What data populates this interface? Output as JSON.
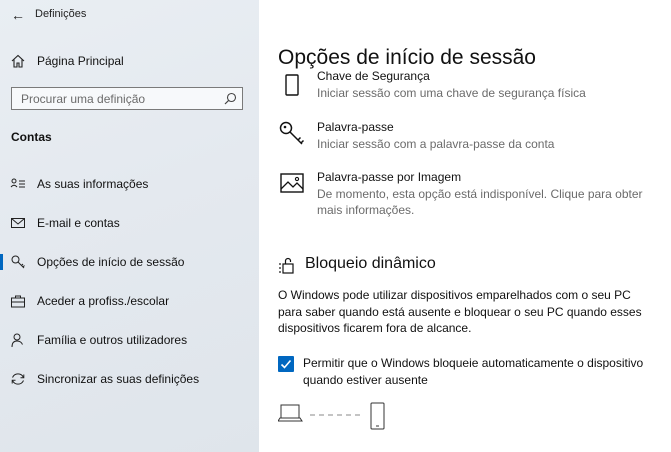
{
  "window": {
    "back_glyph": "←",
    "title": "Definições"
  },
  "sidebar": {
    "home_label": "Página Principal",
    "search": {
      "placeholder": "Procurar uma definição",
      "value": ""
    },
    "section_heading": "Contas",
    "items": [
      {
        "label": "As suas informações",
        "icon": "person-card-icon",
        "selected": false
      },
      {
        "label": "E-mail e contas",
        "icon": "mail-icon",
        "selected": false
      },
      {
        "label": "Opções de início de sessão",
        "icon": "key-icon",
        "selected": true
      },
      {
        "label": "Aceder a profiss./escolar",
        "icon": "briefcase-icon",
        "selected": false
      },
      {
        "label": "Família e outros utilizadores",
        "icon": "person-icon",
        "selected": false
      },
      {
        "label": "Sincronizar as suas definições",
        "icon": "sync-icon",
        "selected": false
      }
    ]
  },
  "main": {
    "title": "Opções de início de sessão",
    "options": [
      {
        "title": "Chave de Segurança",
        "description": "Iniciar sessão com uma chave de segurança física",
        "icon": "usb-key-icon"
      },
      {
        "title": "Palavra-passe",
        "description": "Iniciar sessão com a palavra-passe da conta",
        "icon": "key-icon"
      },
      {
        "title": "Palavra-passe por Imagem",
        "description": "De momento, esta opção está indisponível. Clique para obter mais informações.",
        "icon": "picture-icon"
      }
    ],
    "dynamic_lock": {
      "heading": "Bloqueio dinâmico",
      "description": "O Windows pode utilizar dispositivos emparelhados com o seu PC para saber quando está ausente e bloquear o seu PC quando esses dispositivos ficarem fora de alcance.",
      "checkbox_label": "Permitir que o Windows bloqueie automaticamente o dispositivo quando estiver ausente",
      "checkbox_checked": true
    }
  },
  "colors": {
    "accent": "#0067c0",
    "secondary_text": "#6b6b6b",
    "sidebar_bg": "#e6ebf0"
  }
}
